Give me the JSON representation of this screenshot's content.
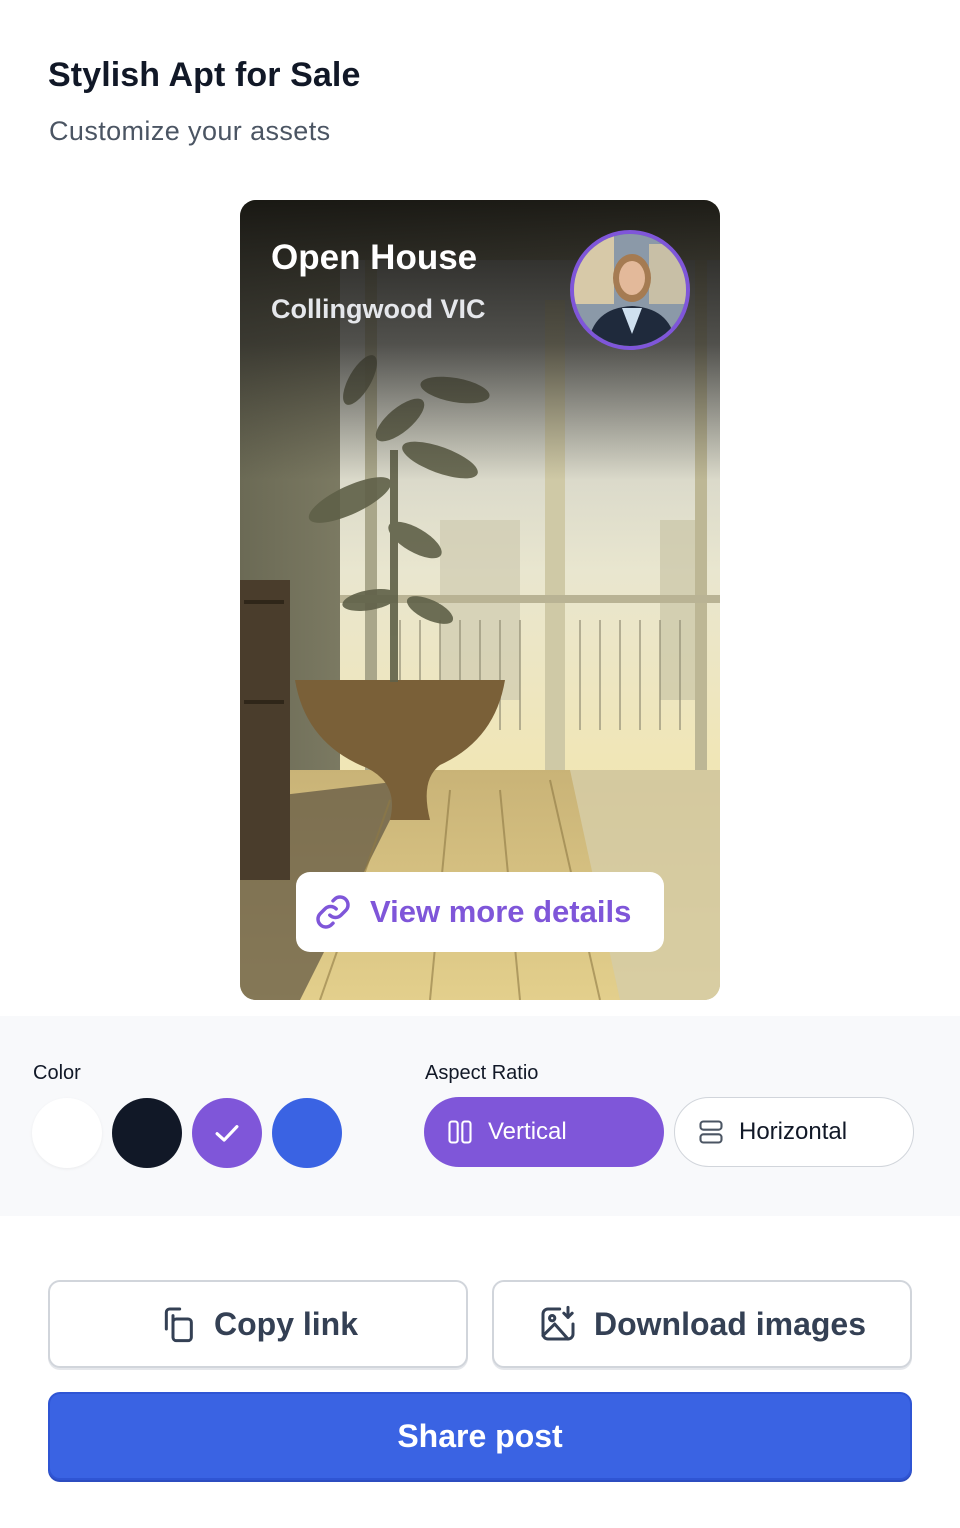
{
  "header": {
    "title": "Stylish Apt for Sale",
    "subtitle": "Customize your assets"
  },
  "preview": {
    "title": "Open House",
    "location": "Collingwood VIC",
    "avatar_alt": "agent-portrait",
    "details_link_label": "View more details",
    "details_icon": "link-icon"
  },
  "settings": {
    "color_label": "Color",
    "colors": [
      {
        "name": "white",
        "hex": "#ffffff",
        "selected": false
      },
      {
        "name": "black",
        "hex": "#111827",
        "selected": false
      },
      {
        "name": "purple",
        "hex": "#7f56d9",
        "selected": true
      },
      {
        "name": "blue",
        "hex": "#3a63e3",
        "selected": false
      }
    ],
    "aspect_label": "Aspect Ratio",
    "aspect_options": [
      {
        "label": "Vertical",
        "icon": "columns-icon",
        "selected": true
      },
      {
        "label": "Horizontal",
        "icon": "rows-icon",
        "selected": false
      }
    ]
  },
  "actions": {
    "copy_link": "Copy link",
    "download_images": "Download images",
    "share_post": "Share post"
  },
  "theme": {
    "accent": "#7f56d9",
    "primary": "#3a63e3"
  }
}
